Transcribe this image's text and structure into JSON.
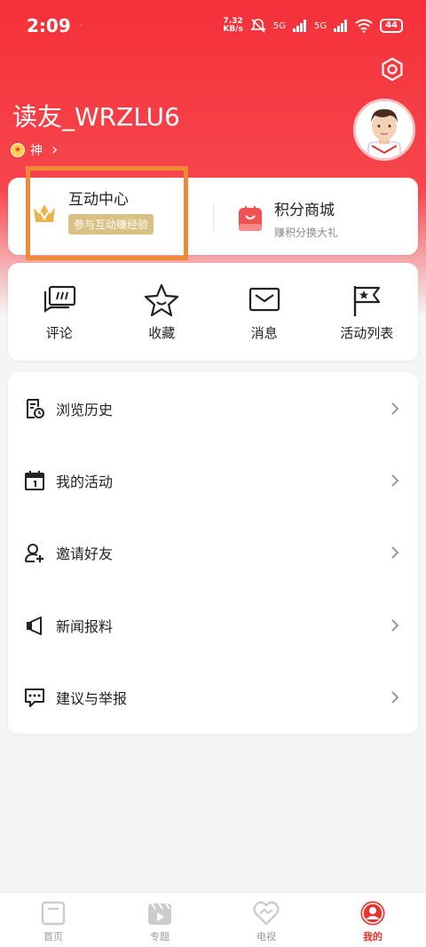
{
  "status_bar": {
    "time": "2:09",
    "dot": "·",
    "net_speed_value": "7.32",
    "net_speed_unit": "KB/s",
    "signal1": "5G",
    "signal2": "5G",
    "battery": "44"
  },
  "profile": {
    "username": "读友_WRZLU6",
    "level": "神",
    "level_arrow": "›"
  },
  "interaction_card": {
    "interact_title": "互动中心",
    "interact_sub": "参与互动赚经验",
    "shop_title": "积分商城",
    "shop_sub": "赚积分换大礼"
  },
  "quick_actions": [
    {
      "label": "评论",
      "icon": "comment-icon"
    },
    {
      "label": "收藏",
      "icon": "star-icon"
    },
    {
      "label": "消息",
      "icon": "mail-icon"
    },
    {
      "label": "活动列表",
      "icon": "flag-icon"
    }
  ],
  "menu": [
    {
      "label": "浏览历史",
      "icon": "history-icon"
    },
    {
      "label": "我的活动",
      "icon": "calendar-icon"
    },
    {
      "label": "邀请好友",
      "icon": "invite-icon"
    },
    {
      "label": "新闻报料",
      "icon": "broadcast-icon"
    },
    {
      "label": "建议与举报",
      "icon": "feedback-icon"
    }
  ],
  "tabbar": [
    {
      "label": "首页",
      "icon": "home-icon",
      "active": false
    },
    {
      "label": "专题",
      "icon": "topic-icon",
      "active": false
    },
    {
      "label": "电视",
      "icon": "tv-icon",
      "active": false
    },
    {
      "label": "我的",
      "icon": "profile-icon",
      "active": true
    }
  ],
  "colors": {
    "brand_red": "#f5303a",
    "active_tab": "#e8342c",
    "gold": "#d9c183",
    "highlight": "#f08a36"
  }
}
